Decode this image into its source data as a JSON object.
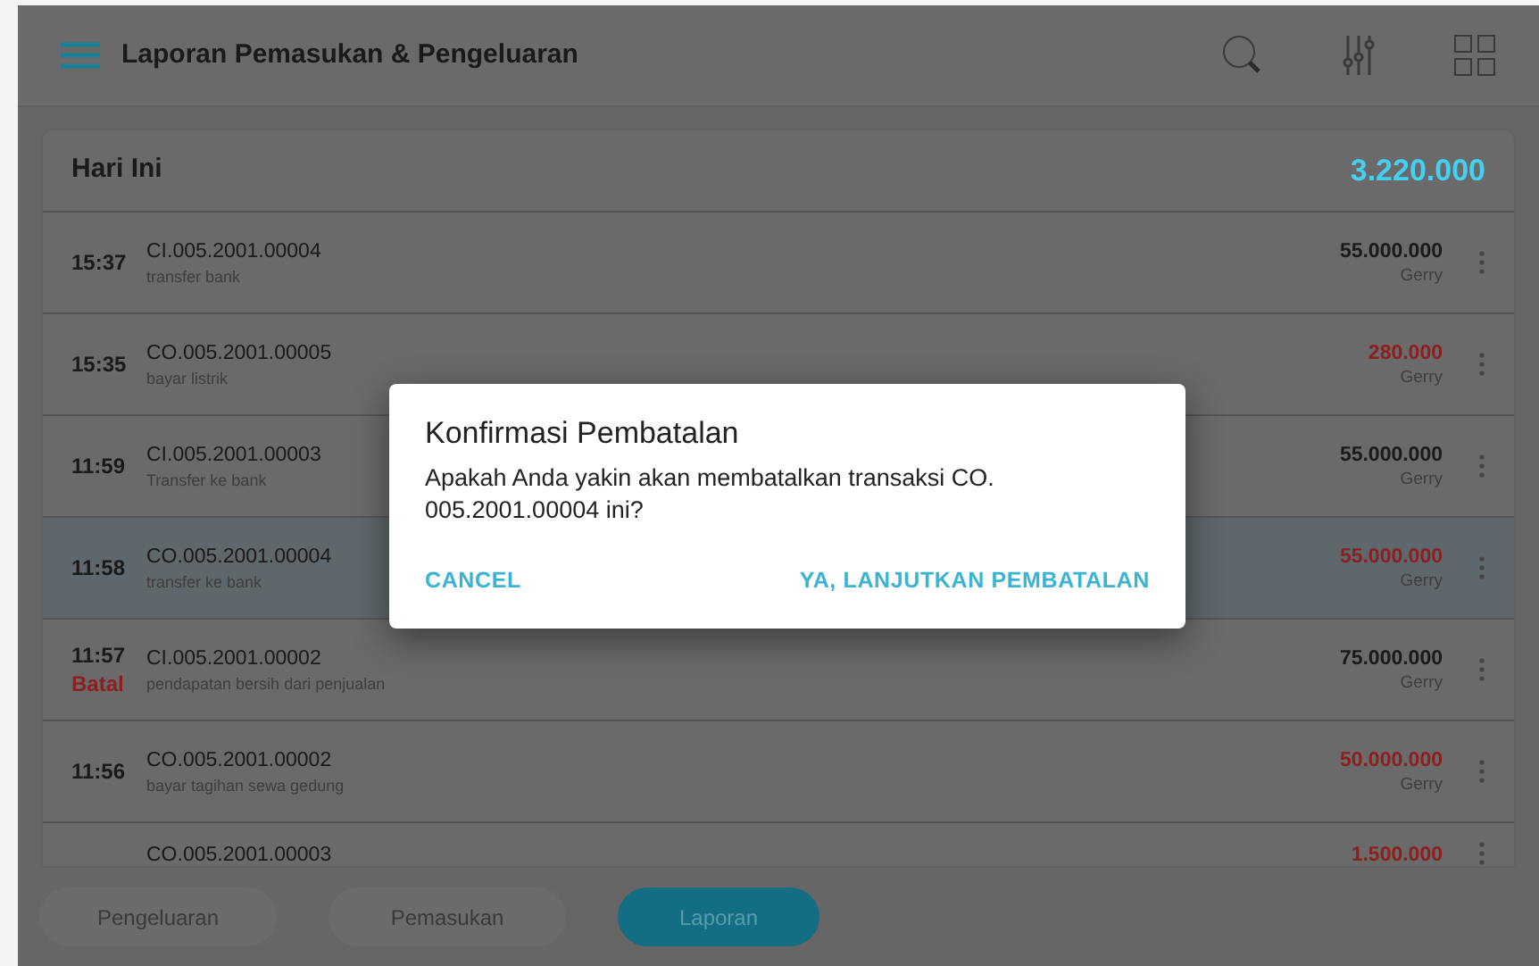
{
  "app_bar": {
    "title": "Laporan Pemasukan & Pengeluaran"
  },
  "section": {
    "title": "Hari Ini",
    "total": "3.220.000"
  },
  "transactions": [
    {
      "time": "15:37",
      "code": "CI.005.2001.00004",
      "note": "transfer bank",
      "amount": "55.000.000",
      "user": "Gerry",
      "kind": "income",
      "selected": false
    },
    {
      "time": "15:35",
      "code": "CO.005.2001.00005",
      "note": "bayar listrik",
      "amount": "280.000",
      "user": "Gerry",
      "kind": "expense",
      "selected": false
    },
    {
      "time": "11:59",
      "code": "CI.005.2001.00003",
      "note": "Transfer ke bank",
      "amount": "55.000.000",
      "user": "Gerry",
      "kind": "income",
      "selected": false
    },
    {
      "time": "11:58",
      "code": "CO.005.2001.00004",
      "note": "transfer ke bank",
      "amount": "55.000.000",
      "user": "Gerry",
      "kind": "expense",
      "selected": true
    },
    {
      "time": "11:57",
      "status": "Batal",
      "code": "CI.005.2001.00002",
      "note": "pendapatan bersih dari penjualan",
      "amount": "75.000.000",
      "user": "Gerry",
      "kind": "income",
      "selected": false
    },
    {
      "time": "11:56",
      "code": "CO.005.2001.00002",
      "note": "bayar tagihan sewa gedung",
      "amount": "50.000.000",
      "user": "Gerry",
      "kind": "expense",
      "selected": false
    },
    {
      "code": "CO.005.2001.00003",
      "amount": "1.500.000",
      "kind": "expense",
      "selected": false
    }
  ],
  "bottom_tabs": [
    {
      "label": "Pengeluaran",
      "selected": false
    },
    {
      "label": "Pemasukan",
      "selected": false
    },
    {
      "label": "Laporan",
      "selected": true
    }
  ],
  "dialog": {
    "title": "Konfirmasi Pembatalan",
    "message": "Apakah Anda yakin akan membatalkan transaksi CO. 005.2001.00004 ini?",
    "buttons": [
      "CANCEL",
      "YA, LANJUTKAN PEMBATALAN"
    ]
  }
}
